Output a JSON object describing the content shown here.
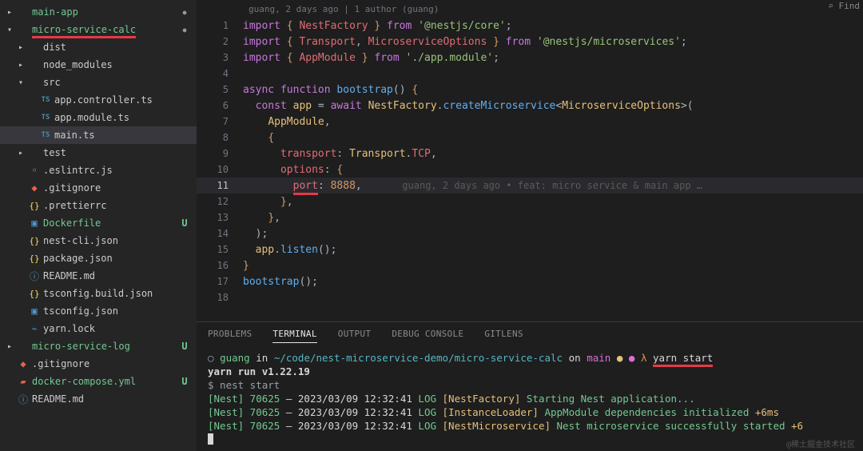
{
  "sidebar": {
    "rows": [
      {
        "indent": 0,
        "chev": "▸",
        "iconCls": "ico-folder",
        "glyph": "",
        "label": "main-app",
        "green": true,
        "tail": "dot"
      },
      {
        "indent": 0,
        "chev": "▾",
        "iconCls": "ico-folder",
        "glyph": "",
        "label": "micro-service-calc",
        "green": true,
        "underline": true,
        "tail": "dot"
      },
      {
        "indent": 1,
        "chev": "▸",
        "iconCls": "ico-folder",
        "glyph": "",
        "label": "dist"
      },
      {
        "indent": 1,
        "chev": "▸",
        "iconCls": "ico-folder",
        "glyph": "",
        "label": "node_modules"
      },
      {
        "indent": 1,
        "chev": "▾",
        "iconCls": "ico-folder",
        "glyph": "",
        "label": "src"
      },
      {
        "indent": 2,
        "chev": "",
        "iconCls": "ico-ts",
        "glyph": "TS",
        "label": "app.controller.ts"
      },
      {
        "indent": 2,
        "chev": "",
        "iconCls": "ico-ts",
        "glyph": "TS",
        "label": "app.module.ts"
      },
      {
        "indent": 2,
        "chev": "",
        "iconCls": "ico-ts",
        "glyph": "TS",
        "label": "main.ts",
        "selected": true
      },
      {
        "indent": 1,
        "chev": "▸",
        "iconCls": "ico-folder",
        "glyph": "",
        "label": "test"
      },
      {
        "indent": 1,
        "chev": "",
        "iconCls": "ico-js",
        "glyph": "◦",
        "label": ".eslintrc.js"
      },
      {
        "indent": 1,
        "chev": "",
        "iconCls": "ico-git",
        "glyph": "◆",
        "label": ".gitignore"
      },
      {
        "indent": 1,
        "chev": "",
        "iconCls": "ico-json",
        "glyph": "{}",
        "label": ".prettierrc"
      },
      {
        "indent": 1,
        "chev": "",
        "iconCls": "ico-docker",
        "glyph": "▣",
        "label": "Dockerfile",
        "green": true,
        "tail": "U"
      },
      {
        "indent": 1,
        "chev": "",
        "iconCls": "ico-json",
        "glyph": "{}",
        "label": "nest-cli.json"
      },
      {
        "indent": 1,
        "chev": "",
        "iconCls": "ico-json",
        "glyph": "{}",
        "label": "package.json"
      },
      {
        "indent": 1,
        "chev": "",
        "iconCls": "ico-md",
        "glyph": "ⓘ",
        "label": "README.md"
      },
      {
        "indent": 1,
        "chev": "",
        "iconCls": "ico-json",
        "glyph": "{}",
        "label": "tsconfig.build.json"
      },
      {
        "indent": 1,
        "chev": "",
        "iconCls": "ico-docker",
        "glyph": "▣",
        "label": "tsconfig.json"
      },
      {
        "indent": 1,
        "chev": "",
        "iconCls": "ico-yarn",
        "glyph": "⌁",
        "label": "yarn.lock"
      },
      {
        "indent": 0,
        "chev": "▸",
        "iconCls": "ico-folder",
        "glyph": "",
        "label": "micro-service-log",
        "green": true,
        "tail": "U"
      },
      {
        "indent": 0,
        "chev": "",
        "iconCls": "ico-git",
        "glyph": "◆",
        "label": ".gitignore"
      },
      {
        "indent": 0,
        "chev": "",
        "iconCls": "ico-yml",
        "glyph": "▰",
        "label": "docker-compose.yml",
        "green": true,
        "tail": "U"
      },
      {
        "indent": 0,
        "chev": "",
        "iconCls": "ico-md",
        "glyph": "ⓘ",
        "label": "README.md"
      }
    ]
  },
  "blame": "guang, 2 days ago | 1 author (guang)",
  "code": [
    [
      [
        "c-kw",
        "import "
      ],
      [
        "c-pn",
        "{ "
      ],
      [
        "c-var",
        "NestFactory"
      ],
      [
        "c-pn",
        " }"
      ],
      [
        "c-kw",
        " from "
      ],
      [
        "c-str",
        "'@nestjs/core'"
      ],
      [
        "c-op",
        ";"
      ]
    ],
    [
      [
        "c-kw",
        "import "
      ],
      [
        "c-pn",
        "{ "
      ],
      [
        "c-var",
        "Transport"
      ],
      [
        "c-op",
        ", "
      ],
      [
        "c-var",
        "MicroserviceOptions"
      ],
      [
        "c-pn",
        " }"
      ],
      [
        "c-kw",
        " from "
      ],
      [
        "c-str",
        "'@nestjs/microservices'"
      ],
      [
        "c-op",
        ";"
      ]
    ],
    [
      [
        "c-kw",
        "import "
      ],
      [
        "c-pn",
        "{ "
      ],
      [
        "c-var",
        "AppModule"
      ],
      [
        "c-pn",
        " }"
      ],
      [
        "c-kw",
        " from "
      ],
      [
        "c-str",
        "'./app.module'"
      ],
      [
        "c-op",
        ";"
      ]
    ],
    [],
    [
      [
        "c-kw",
        "async "
      ],
      [
        "c-kw",
        "function "
      ],
      [
        "c-fn",
        "bootstrap"
      ],
      [
        "c-op",
        "() "
      ],
      [
        "c-pn",
        "{"
      ]
    ],
    [
      [
        "c-def",
        "  "
      ],
      [
        "c-kw",
        "const "
      ],
      [
        "c-type",
        "app"
      ],
      [
        "c-op",
        " = "
      ],
      [
        "c-kw",
        "await "
      ],
      [
        "c-type",
        "NestFactory"
      ],
      [
        "c-op",
        "."
      ],
      [
        "c-fn",
        "createMicroservice"
      ],
      [
        "c-op",
        "<"
      ],
      [
        "c-type",
        "MicroserviceOptions"
      ],
      [
        "c-op",
        ">("
      ]
    ],
    [
      [
        "c-def",
        "    "
      ],
      [
        "c-type",
        "AppModule"
      ],
      [
        "c-op",
        ","
      ]
    ],
    [
      [
        "c-def",
        "    "
      ],
      [
        "c-pn",
        "{"
      ]
    ],
    [
      [
        "c-def",
        "      "
      ],
      [
        "c-prop",
        "transport"
      ],
      [
        "c-op",
        ": "
      ],
      [
        "c-type",
        "Transport"
      ],
      [
        "c-op",
        "."
      ],
      [
        "c-var",
        "TCP"
      ],
      [
        "c-op",
        ","
      ]
    ],
    [
      [
        "c-def",
        "      "
      ],
      [
        "c-prop",
        "options"
      ],
      [
        "c-op",
        ": "
      ],
      [
        "c-pn",
        "{"
      ]
    ],
    [
      [
        "c-def",
        "        "
      ],
      [
        "c-prop",
        "port"
      ],
      [
        "c-op",
        ": "
      ],
      [
        "c-num",
        "8888"
      ],
      [
        "c-op",
        ","
      ],
      [
        "c-ghost",
        "       guang, 2 days ago • feat: micro service & main app …"
      ]
    ],
    [
      [
        "c-def",
        "      "
      ],
      [
        "c-pn",
        "}"
      ],
      [
        "c-op",
        ","
      ]
    ],
    [
      [
        "c-def",
        "    "
      ],
      [
        "c-pn",
        "}"
      ],
      [
        "c-op",
        ","
      ]
    ],
    [
      [
        "c-def",
        "  "
      ],
      [
        "c-op",
        ");"
      ]
    ],
    [
      [
        "c-def",
        "  "
      ],
      [
        "c-type",
        "app"
      ],
      [
        "c-op",
        "."
      ],
      [
        "c-fn",
        "listen"
      ],
      [
        "c-op",
        "();"
      ]
    ],
    [
      [
        "c-pn",
        "}"
      ]
    ],
    [
      [
        "c-fn",
        "bootstrap"
      ],
      [
        "c-op",
        "();"
      ]
    ],
    []
  ],
  "current_line": 11,
  "underline_port_at": 11,
  "panel": {
    "tabs": [
      "PROBLEMS",
      "TERMINAL",
      "OUTPUT",
      "DEBUG CONSOLE",
      "GITLENS"
    ],
    "active": 1
  },
  "terminal": {
    "prompt": {
      "user": "guang",
      "in": "in",
      "path": "~/code/nest-microservice-demo/micro-service-calc",
      "on": "on",
      "branch": "main",
      "bullets": "● ●",
      "lambda": "λ",
      "cmd": "yarn start"
    },
    "lines": [
      [
        [
          "t-wht bold",
          "yarn run v1.22.19"
        ]
      ],
      [
        [
          "t-dim",
          "$ nest start"
        ]
      ],
      [
        [
          "t-gr",
          "[Nest] 70625  "
        ],
        [
          "t-wht",
          "– 2023/03/09 12:32:41     "
        ],
        [
          "t-gr",
          "LOG "
        ],
        [
          "t-yel",
          "[NestFactory] "
        ],
        [
          "t-gr",
          "Starting Nest application..."
        ]
      ],
      [
        [
          "t-gr",
          "[Nest] 70625  "
        ],
        [
          "t-wht",
          "– 2023/03/09 12:32:41     "
        ],
        [
          "t-gr",
          "LOG "
        ],
        [
          "t-yel",
          "[InstanceLoader] "
        ],
        [
          "t-gr",
          "AppModule dependencies initialized "
        ],
        [
          "t-yel",
          "+6ms"
        ]
      ],
      [
        [
          "t-gr",
          "[Nest] 70625  "
        ],
        [
          "t-wht",
          "– 2023/03/09 12:32:41     "
        ],
        [
          "t-gr",
          "LOG "
        ],
        [
          "t-yel",
          "[NestMicroservice] "
        ],
        [
          "t-gr",
          "Nest microservice successfully started "
        ],
        [
          "t-yel",
          "+6"
        ]
      ]
    ]
  },
  "watermark": "@稀土掘金技术社区",
  "find_hint": "⌕ Find"
}
